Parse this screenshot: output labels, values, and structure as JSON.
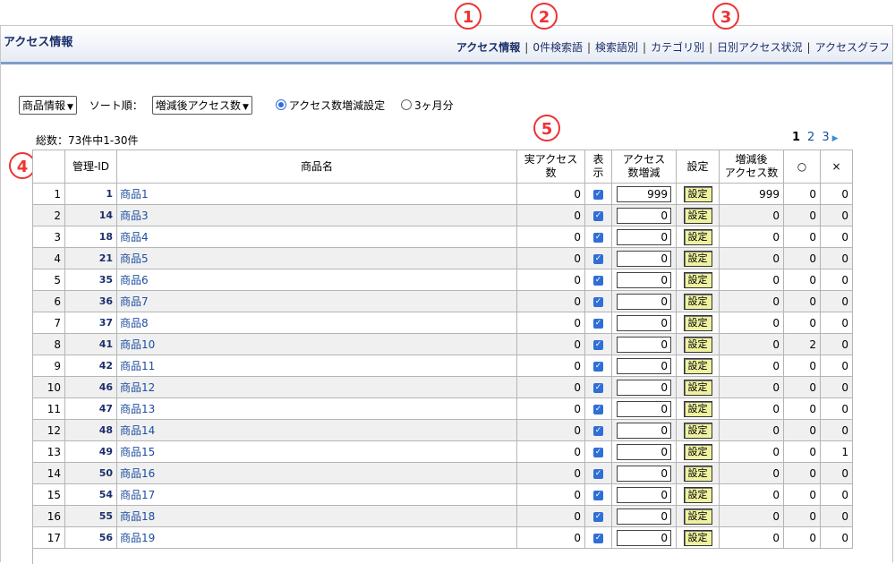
{
  "header": {
    "title": "アクセス情報",
    "nav": [
      "アクセス情報",
      "0件検索語",
      "検索語別",
      "カテゴリ別",
      "日別アクセス状況",
      "アクセスグラフ"
    ],
    "active_index": 0
  },
  "badges": [
    "1",
    "2",
    "3",
    "4",
    "5"
  ],
  "controls": {
    "category_select": "商品情報",
    "sort_label": "ソート順：",
    "sort_select": "増減後アクセス数",
    "radio_1": "アクセス数増減設定",
    "radio_1_selected": true,
    "radio_2": "3ヶ月分"
  },
  "total_text": "総数：73件中1-30件",
  "pager": {
    "current": "1",
    "pages": [
      "2",
      "3"
    ]
  },
  "table": {
    "headers": {
      "mgmt_id": "管理-ID",
      "name": "商品名",
      "real_access": "実アクセス数",
      "display": "表示",
      "access_delta_1": "アクセス",
      "access_delta_2": "数増減",
      "setting": "設定",
      "after_1": "増減後",
      "after_2": "アクセス数",
      "circle": "○",
      "cross": "×"
    },
    "button_label": "設定",
    "rows": [
      {
        "no": "1",
        "id": "1",
        "name": "商品1",
        "real": "0",
        "display": true,
        "delta": "999",
        "after": "999",
        "circle": "0",
        "cross": "0"
      },
      {
        "no": "2",
        "id": "14",
        "name": "商品3",
        "real": "0",
        "display": true,
        "delta": "0",
        "after": "0",
        "circle": "0",
        "cross": "0"
      },
      {
        "no": "3",
        "id": "18",
        "name": "商品4",
        "real": "0",
        "display": true,
        "delta": "0",
        "after": "0",
        "circle": "0",
        "cross": "0"
      },
      {
        "no": "4",
        "id": "21",
        "name": "商品5",
        "real": "0",
        "display": true,
        "delta": "0",
        "after": "0",
        "circle": "0",
        "cross": "0"
      },
      {
        "no": "5",
        "id": "35",
        "name": "商品6",
        "real": "0",
        "display": true,
        "delta": "0",
        "after": "0",
        "circle": "0",
        "cross": "0"
      },
      {
        "no": "6",
        "id": "36",
        "name": "商品7",
        "real": "0",
        "display": true,
        "delta": "0",
        "after": "0",
        "circle": "0",
        "cross": "0"
      },
      {
        "no": "7",
        "id": "37",
        "name": "商品8",
        "real": "0",
        "display": true,
        "delta": "0",
        "after": "0",
        "circle": "0",
        "cross": "0"
      },
      {
        "no": "8",
        "id": "41",
        "name": "商品10",
        "real": "0",
        "display": true,
        "delta": "0",
        "after": "0",
        "circle": "2",
        "cross": "0"
      },
      {
        "no": "9",
        "id": "42",
        "name": "商品11",
        "real": "0",
        "display": true,
        "delta": "0",
        "after": "0",
        "circle": "0",
        "cross": "0"
      },
      {
        "no": "10",
        "id": "46",
        "name": "商品12",
        "real": "0",
        "display": true,
        "delta": "0",
        "after": "0",
        "circle": "0",
        "cross": "0"
      },
      {
        "no": "11",
        "id": "47",
        "name": "商品13",
        "real": "0",
        "display": true,
        "delta": "0",
        "after": "0",
        "circle": "0",
        "cross": "0"
      },
      {
        "no": "12",
        "id": "48",
        "name": "商品14",
        "real": "0",
        "display": true,
        "delta": "0",
        "after": "0",
        "circle": "0",
        "cross": "0"
      },
      {
        "no": "13",
        "id": "49",
        "name": "商品15",
        "real": "0",
        "display": true,
        "delta": "0",
        "after": "0",
        "circle": "0",
        "cross": "1"
      },
      {
        "no": "14",
        "id": "50",
        "name": "商品16",
        "real": "0",
        "display": true,
        "delta": "0",
        "after": "0",
        "circle": "0",
        "cross": "0"
      },
      {
        "no": "15",
        "id": "54",
        "name": "商品17",
        "real": "0",
        "display": true,
        "delta": "0",
        "after": "0",
        "circle": "0",
        "cross": "0"
      },
      {
        "no": "16",
        "id": "55",
        "name": "商品18",
        "real": "0",
        "display": true,
        "delta": "0",
        "after": "0",
        "circle": "0",
        "cross": "0"
      },
      {
        "no": "17",
        "id": "56",
        "name": "商品19",
        "real": "0",
        "display": true,
        "delta": "0",
        "after": "0",
        "circle": "0",
        "cross": "0"
      }
    ]
  },
  "colors": {
    "accent": "#1c2f6b",
    "badge": "#ee3333",
    "button_bg": "#eef2a0",
    "header_border": "#7f9cc9"
  }
}
